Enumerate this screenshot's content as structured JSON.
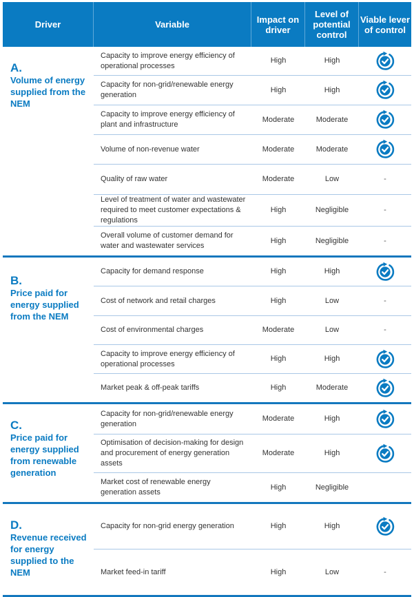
{
  "header": {
    "driver": "Driver",
    "variable": "Variable",
    "impact": "Impact on driver",
    "control": "Level of potential control",
    "lever": "Viable lever of control"
  },
  "colors": {
    "accent": "#0a7bc2",
    "divider": "#a9c7e6"
  },
  "sections": [
    {
      "letter": "A.",
      "driver": "Volume of energy supplied from the NEM",
      "rows": [
        {
          "variable": "Capacity to improve energy efficiency of operational processes",
          "impact": "High",
          "control": "High",
          "lever": "check-cycle-icon"
        },
        {
          "variable": "Capacity for non-grid/renewable energy generation",
          "impact": "High",
          "control": "High",
          "lever": "check-cycle-icon"
        },
        {
          "variable": "Capacity to improve energy efficiency of plant and infrastructure",
          "impact": "Moderate",
          "control": "Moderate",
          "lever": "check-cycle-icon"
        },
        {
          "variable": "Volume of non-revenue water",
          "impact": "Moderate",
          "control": "Moderate",
          "lever": "check-cycle-icon"
        },
        {
          "variable": "Quality of raw water",
          "impact": "Moderate",
          "control": "Low",
          "lever": "-"
        },
        {
          "variable": "Level of treatment of water and wastewater required to meet customer expectations & regulations",
          "impact": "High",
          "control": "Negligible",
          "lever": "-"
        },
        {
          "variable": "Overall volume of customer demand for water and wastewater services",
          "impact": "High",
          "control": "Negligible",
          "lever": "-"
        }
      ]
    },
    {
      "letter": "B.",
      "driver": "Price paid for energy supplied from the NEM",
      "rows": [
        {
          "variable": "Capacity for demand response",
          "impact": "High",
          "control": "High",
          "lever": "check-cycle-icon"
        },
        {
          "variable": "Cost of network and retail charges",
          "impact": "High",
          "control": "Low",
          "lever": "-"
        },
        {
          "variable": "Cost of environmental charges",
          "impact": "Moderate",
          "control": "Low",
          "lever": "-"
        },
        {
          "variable": "Capacity to improve energy efficiency of operational processes",
          "impact": "High",
          "control": "High",
          "lever": "check-cycle-icon"
        },
        {
          "variable": "Market peak & off-peak tariffs",
          "impact": "High",
          "control": "Moderate",
          "lever": "check-cycle-icon"
        }
      ]
    },
    {
      "letter": "C.",
      "driver": "Price paid for energy supplied from renewable generation",
      "rows": [
        {
          "variable": "Capacity for non-grid/renewable energy generation",
          "impact": "Moderate",
          "control": "High",
          "lever": "check-cycle-icon"
        },
        {
          "variable": "Optimisation of decision-making for design and procurement of energy generation assets",
          "impact": "Moderate",
          "control": "High",
          "lever": "check-cycle-icon"
        },
        {
          "variable": "Market cost of renewable energy generation assets",
          "impact": "High",
          "control": "Negligible",
          "lever": ""
        }
      ]
    },
    {
      "letter": "D.",
      "driver": "Revenue received for energy supplied to the NEM",
      "rows": [
        {
          "variable": "Capacity for non-grid energy generation",
          "impact": "High",
          "control": "High",
          "lever": "check-cycle-icon"
        },
        {
          "variable": "Market feed-in tariff",
          "impact": "High",
          "control": "Low",
          "lever": "-"
        }
      ]
    }
  ]
}
